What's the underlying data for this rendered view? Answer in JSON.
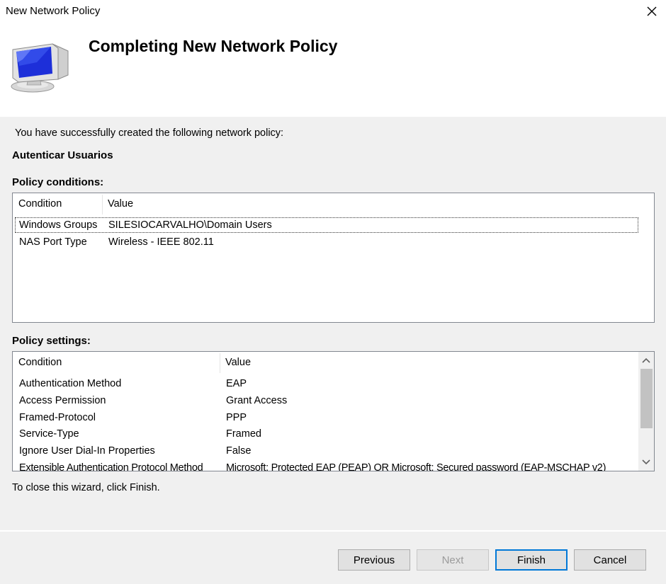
{
  "window": {
    "title": "New Network Policy"
  },
  "header": {
    "heading": "Completing New Network Policy"
  },
  "intro_text": "You have successfully created the following network policy:",
  "policy_name": "Autenticar Usuarios",
  "conditions": {
    "label": "Policy conditions:",
    "columns": [
      "Condition",
      "Value"
    ],
    "rows": [
      {
        "condition": "Windows Groups",
        "value": "SILESIOCARVALHO\\Domain Users"
      },
      {
        "condition": "NAS Port Type",
        "value": "Wireless - IEEE 802.11"
      }
    ]
  },
  "settings": {
    "label": "Policy settings:",
    "columns": [
      "Condition",
      "Value"
    ],
    "rows": [
      {
        "condition": "Authentication Method",
        "value": "EAP"
      },
      {
        "condition": "Access Permission",
        "value": "Grant Access"
      },
      {
        "condition": "Framed-Protocol",
        "value": "PPP"
      },
      {
        "condition": "Service-Type",
        "value": "Framed"
      },
      {
        "condition": "Ignore User Dial-In Properties",
        "value": "False"
      },
      {
        "condition": "Extensible Authentication Protocol Method",
        "value": "Microsoft: Protected EAP (PEAP) OR Microsoft: Secured password (EAP-MSCHAP v2)"
      }
    ]
  },
  "close_text": "To close this wizard, click Finish.",
  "buttons": {
    "previous": "Previous",
    "next": "Next",
    "finish": "Finish",
    "cancel": "Cancel"
  },
  "colors": {
    "focus_border": "#0078d7",
    "panel_border": "#828790"
  }
}
